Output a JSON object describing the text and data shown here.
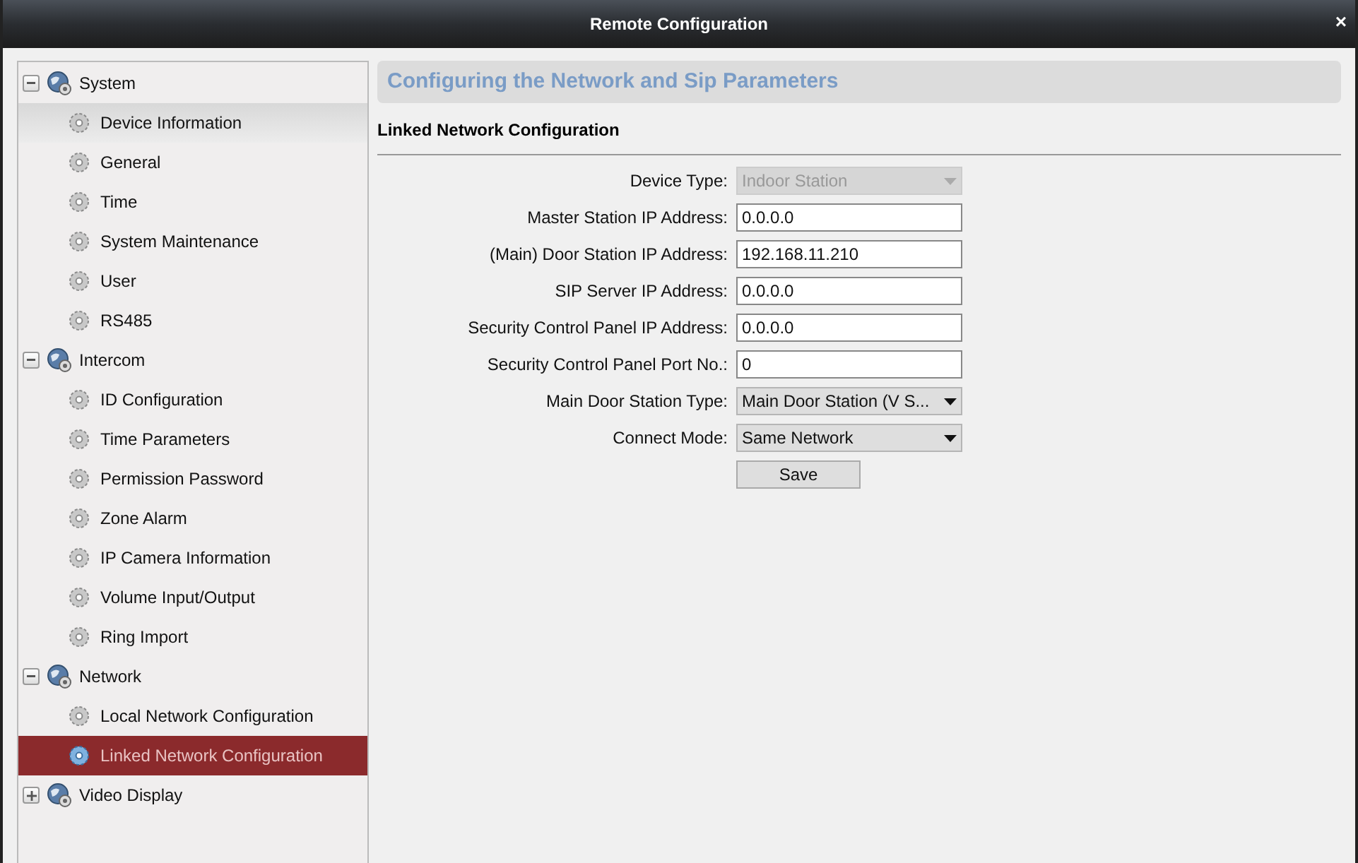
{
  "window": {
    "title": "Remote Configuration",
    "close": "×"
  },
  "sidebar": {
    "groups": [
      {
        "label": "System",
        "expanded": true,
        "children": [
          {
            "label": "Device Information",
            "selected": false,
            "hovered": true
          },
          {
            "label": "General",
            "selected": false,
            "hovered": false
          },
          {
            "label": "Time",
            "selected": false,
            "hovered": false
          },
          {
            "label": "System Maintenance",
            "selected": false,
            "hovered": false
          },
          {
            "label": "User",
            "selected": false,
            "hovered": false
          },
          {
            "label": "RS485",
            "selected": false,
            "hovered": false
          }
        ]
      },
      {
        "label": "Intercom",
        "expanded": true,
        "children": [
          {
            "label": "ID Configuration",
            "selected": false,
            "hovered": false
          },
          {
            "label": "Time Parameters",
            "selected": false,
            "hovered": false
          },
          {
            "label": "Permission Password",
            "selected": false,
            "hovered": false
          },
          {
            "label": "Zone Alarm",
            "selected": false,
            "hovered": false
          },
          {
            "label": "IP Camera Information",
            "selected": false,
            "hovered": false
          },
          {
            "label": "Volume Input/Output",
            "selected": false,
            "hovered": false
          },
          {
            "label": "Ring Import",
            "selected": false,
            "hovered": false
          }
        ]
      },
      {
        "label": "Network",
        "expanded": true,
        "children": [
          {
            "label": "Local Network Configuration",
            "selected": false,
            "hovered": false
          },
          {
            "label": "Linked Network Configuration",
            "selected": true,
            "hovered": false
          }
        ]
      },
      {
        "label": "Video Display",
        "expanded": false
      }
    ]
  },
  "panel": {
    "title": "Configuring the Network and Sip Parameters",
    "section": "Linked Network Configuration",
    "fields": [
      {
        "label": "Device Type:",
        "kind": "select",
        "value": "Indoor Station",
        "disabled": true
      },
      {
        "label": "Master Station IP Address:",
        "kind": "text",
        "value": "0.0.0.0",
        "disabled": false
      },
      {
        "label": "(Main) Door Station IP Address:",
        "kind": "text",
        "value": "192.168.11.210",
        "disabled": false
      },
      {
        "label": "SIP Server IP Address:",
        "kind": "text",
        "value": "0.0.0.0",
        "disabled": false
      },
      {
        "label": "Security Control Panel IP Address:",
        "kind": "text",
        "value": "0.0.0.0",
        "disabled": false
      },
      {
        "label": "Security Control Panel Port No.:",
        "kind": "text",
        "value": "0",
        "disabled": false
      },
      {
        "label": "Main Door Station Type:",
        "kind": "select",
        "value": "Main Door Station (V S...",
        "disabled": false
      },
      {
        "label": "Connect Mode:",
        "kind": "select",
        "value": "Same Network",
        "disabled": false
      }
    ],
    "save": "Save"
  }
}
